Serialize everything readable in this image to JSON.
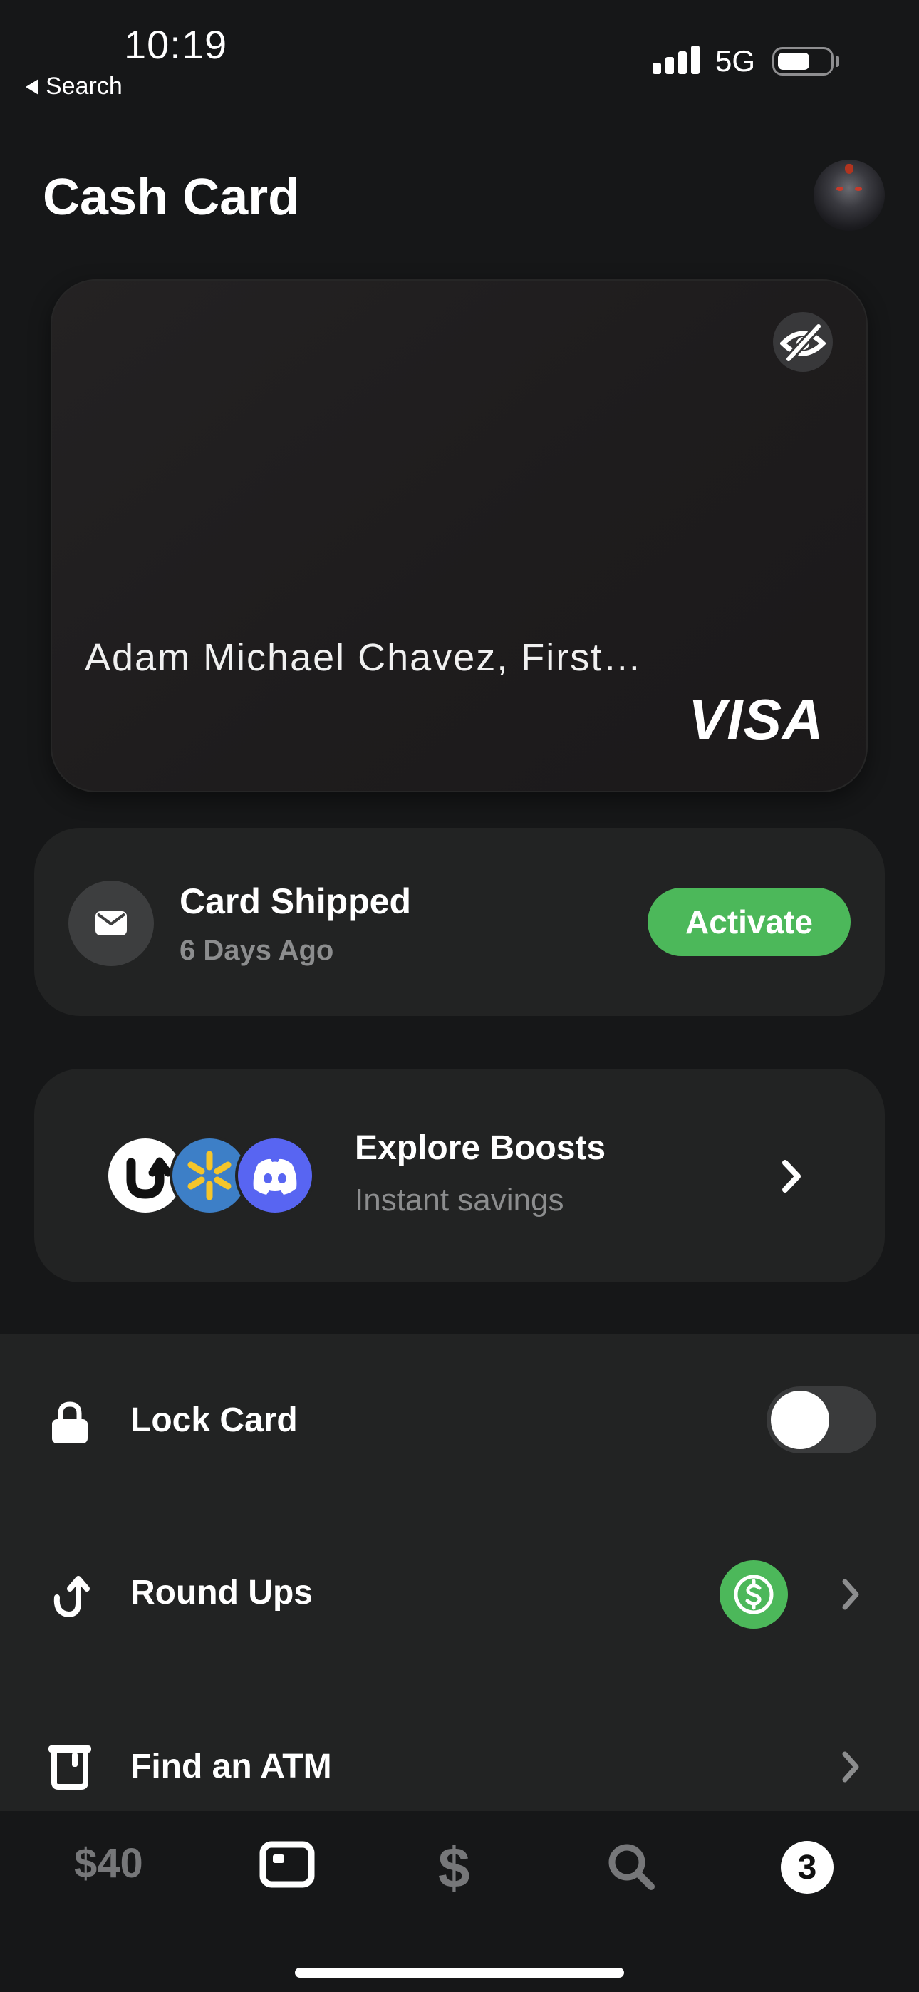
{
  "status_bar": {
    "time": "10:19",
    "back_label": "Search",
    "network": "5G"
  },
  "header": {
    "title": "Cash Card"
  },
  "card": {
    "holder_name": "Adam Michael Chavez, First…",
    "network_brand": "VISA"
  },
  "shipping": {
    "title": "Card Shipped",
    "subtitle": "6 Days Ago",
    "action_label": "Activate"
  },
  "boosts": {
    "title": "Explore Boosts",
    "subtitle": "Instant savings",
    "logos": [
      "upside-logo",
      "walmart-logo",
      "discord-logo"
    ]
  },
  "settings": {
    "lock_card": {
      "label": "Lock Card",
      "enabled": false
    },
    "round_ups": {
      "label": "Round Ups"
    },
    "find_atm": {
      "label": "Find an ATM"
    }
  },
  "tab_bar": {
    "balance": "$40",
    "activity_count": "3"
  },
  "colors": {
    "background": "#161718",
    "panel": "#222323",
    "accent_green": "#4cb85a",
    "muted_text": "#8c8d8e"
  }
}
